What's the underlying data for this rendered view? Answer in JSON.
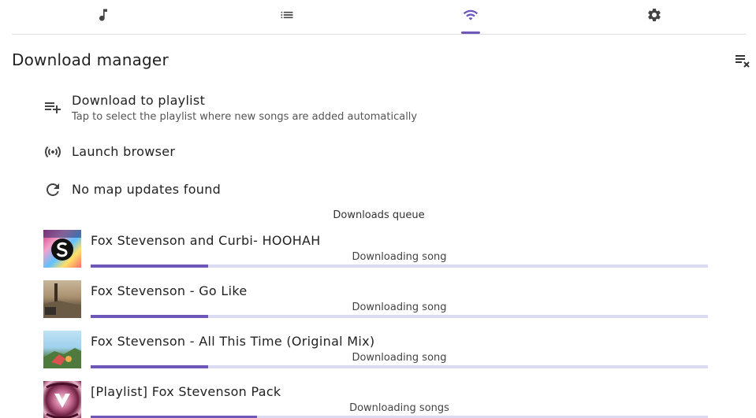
{
  "tabs": [
    {
      "icon": "music-note-icon"
    },
    {
      "icon": "list-icon"
    },
    {
      "icon": "wifi-icon",
      "active": true
    },
    {
      "icon": "gear-icon"
    }
  ],
  "accent_color": "#6e57b8",
  "header": {
    "title": "Download manager",
    "clear_icon": "clear-queue-icon"
  },
  "menu": {
    "download_to_playlist": {
      "label": "Download to playlist",
      "subtitle": "Tap to select the playlist where new songs are added automatically",
      "icon": "playlist-add-icon"
    },
    "launch_browser": {
      "label": "Launch browser",
      "icon": "broadcast-icon"
    },
    "map_updates": {
      "label": "No map updates found",
      "icon": "refresh-icon"
    }
  },
  "queue": {
    "title": "Downloads queue",
    "items": [
      {
        "name": "Fox Stevenson and Curbi- HOOHAH",
        "status": "Downloading song",
        "progress": 0.19
      },
      {
        "name": "Fox Stevenson - Go Like",
        "status": "Downloading song",
        "progress": 0.19
      },
      {
        "name": "Fox Stevenson - All This Time (Original Mix)",
        "status": "Downloading song",
        "progress": 0.19
      },
      {
        "name": "[Playlist] Fox Stevenson Pack",
        "status": "Downloading songs",
        "progress": 0.27
      }
    ]
  }
}
